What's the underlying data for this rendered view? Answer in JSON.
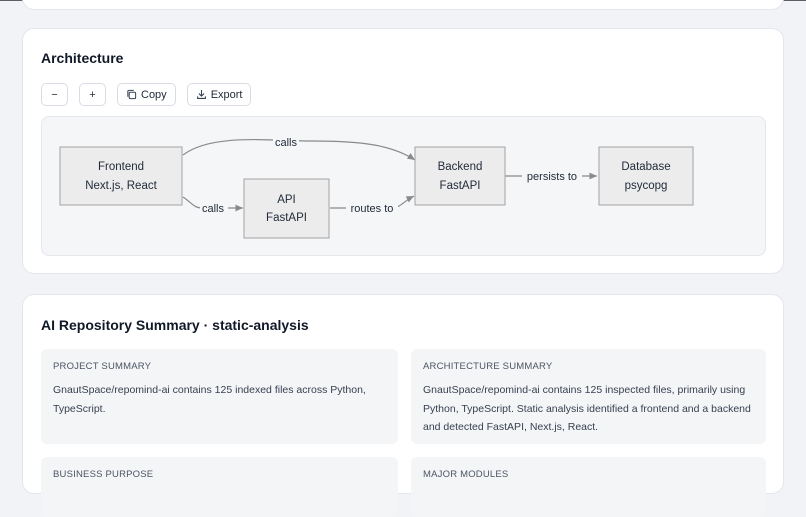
{
  "architecture": {
    "title": "Architecture",
    "toolbar": {
      "zoom_out_label": "−",
      "zoom_in_label": "+",
      "copy_label": "Copy",
      "export_label": "Export",
      "copy_icon": "copy-icon",
      "export_icon": "download-icon"
    },
    "diagram": {
      "nodes": [
        {
          "id": "frontend",
          "line1": "Frontend",
          "line2": "Next.js, React"
        },
        {
          "id": "api",
          "line1": "API",
          "line2": "FastAPI"
        },
        {
          "id": "backend",
          "line1": "Backend",
          "line2": "FastAPI"
        },
        {
          "id": "database",
          "line1": "Database",
          "line2": "psycopg"
        }
      ],
      "edges": [
        {
          "from": "frontend",
          "to": "backend",
          "label": "calls"
        },
        {
          "from": "frontend",
          "to": "api",
          "label": "calls"
        },
        {
          "from": "api",
          "to": "backend",
          "label": "routes to"
        },
        {
          "from": "backend",
          "to": "database",
          "label": "persists to"
        }
      ],
      "colors": {
        "node_fill": "#ececec",
        "node_stroke": "#a3a3a3",
        "edge": "#8a8a8a"
      }
    }
  },
  "summary": {
    "title": "AI Repository Summary · static-analysis",
    "project_summary": {
      "label": "PROJECT SUMMARY",
      "text": "GnautSpace/repomind-ai contains 125 indexed files across Python, TypeScript."
    },
    "architecture_summary": {
      "label": "ARCHITECTURE SUMMARY",
      "text": "GnautSpace/repomind-ai contains 125 inspected files, primarily using Python, TypeScript. Static analysis identified a frontend and a backend and detected FastAPI, Next.js, React."
    },
    "business_purpose": {
      "label": "BUSINESS PURPOSE"
    },
    "major_modules": {
      "label": "MAJOR MODULES"
    }
  }
}
